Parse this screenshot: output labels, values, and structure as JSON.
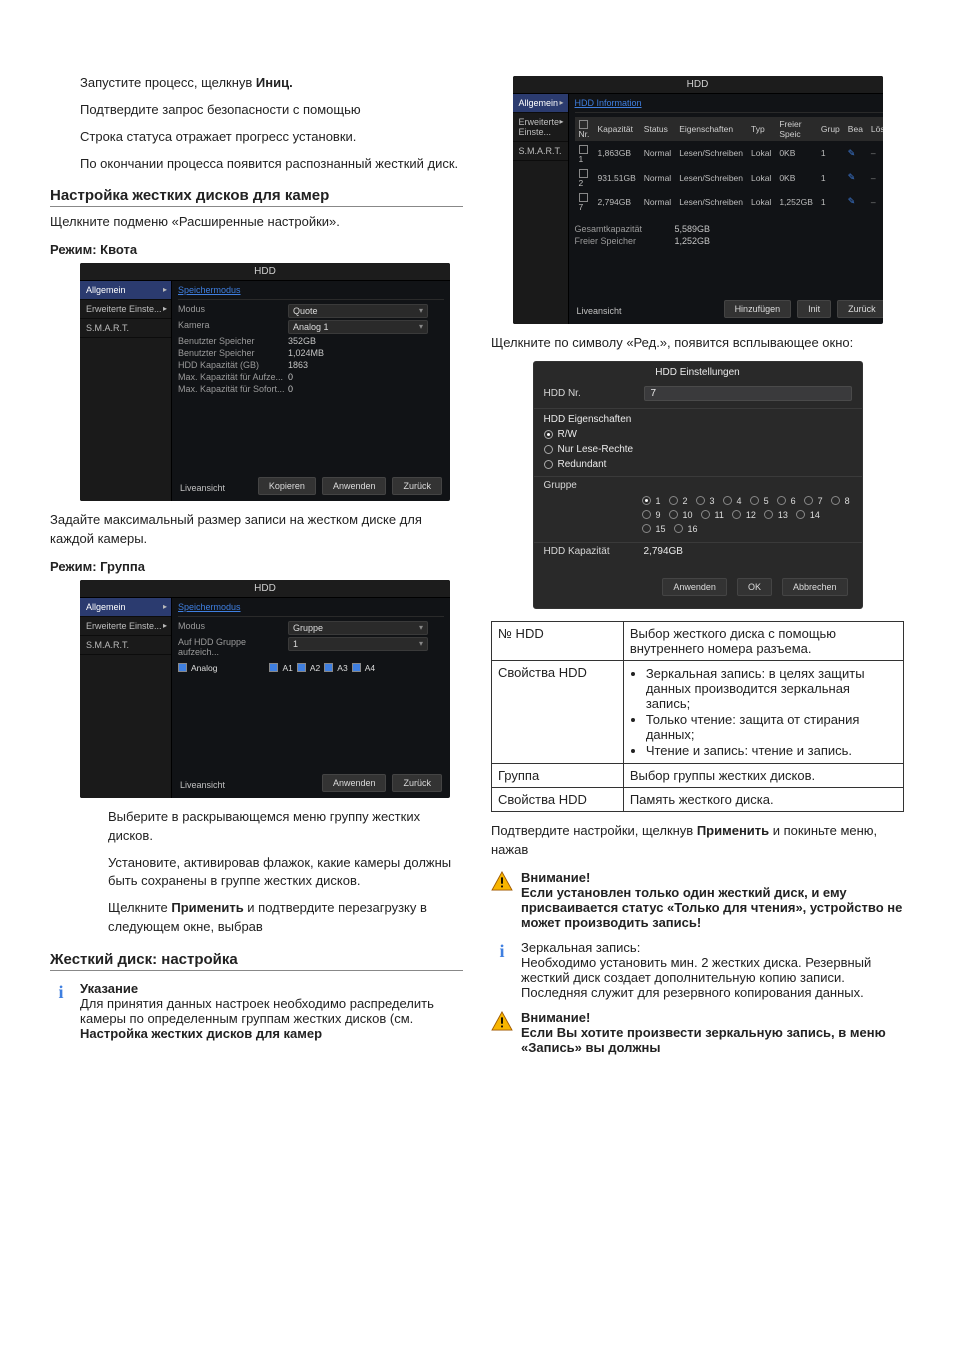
{
  "left": {
    "intro": [
      {
        "pre": "Запустите процесс, щелкнув ",
        "b": "Иниц.",
        "post": ""
      },
      {
        "pre": "Подтвердите запрос безопасности с помощью",
        "b": "",
        "post": ""
      }
    ],
    "intro2": [
      "Строка статуса отражает прогресс установки.",
      "По окончании процесса появится распознанный жесткий диск."
    ],
    "h_cam": "Настройка жестких дисков для камер",
    "p_cam": "Щелкните подменю «Расширенные настройки».",
    "mode_quota_h": "Режим: Квота",
    "quota_panel": {
      "title": "HDD",
      "side": [
        "Allgemein",
        "Erweiterte Einste...",
        "S.M.A.R.T."
      ],
      "tab": "Speichermodus",
      "rows": [
        {
          "k": "Modus",
          "v": "Quote",
          "dd": true
        },
        {
          "k": "Kamera",
          "v": "Analog 1",
          "dd": true
        },
        {
          "k": "Benutzter Speicher",
          "v": "352GB"
        },
        {
          "k": "Benutzter Speicher",
          "v": "1,024MB"
        },
        {
          "k": "HDD Kapazität (GB)",
          "v": "1863"
        },
        {
          "k": "Max. Kapazität für Aufze...",
          "v": "0"
        },
        {
          "k": "Max. Kapazität für Sofort...",
          "v": "0"
        }
      ],
      "btns": [
        "Kopieren",
        "Anwenden",
        "Zurück"
      ],
      "live": "Liveansicht"
    },
    "quota_desc": "Задайте максимальный размер записи на жестком диске для каждой камеры.",
    "mode_group_h": "Режим: Группа",
    "group_panel": {
      "title": "HDD",
      "side": [
        "Allgemein",
        "Erweiterte Einste...",
        "S.M.A.R.T."
      ],
      "tab": "Speichermodus",
      "rows": [
        {
          "k": "Modus",
          "v": "Gruppe",
          "dd": true
        },
        {
          "k": "Auf HDD Gruppe aufzeich...",
          "v": "1",
          "dd": true
        }
      ],
      "analog_label": "Analog",
      "checks": [
        "A1",
        "A2",
        "A3",
        "A4"
      ],
      "btns": [
        "Anwenden",
        "Zurück"
      ],
      "live": "Liveansicht"
    },
    "group_bullets": [
      "Выберите в раскрывающемся меню группу жестких дисков.",
      "Установите, активировав флажок, какие камеры должны быть сохранены в группе жестких дисков.",
      {
        "pre": "Щелкните ",
        "b": "Применить",
        "post": " и подтвердите перезагрузку в следующем окне, выбрав"
      }
    ],
    "h_hdd": "Жесткий диск: настройка",
    "note_h": "Указание",
    "note_body_1": "Для принятия данных настроек необходимо распределить камеры по определенным группам жестких дисков (см. ",
    "note_body_b": "Настройка жестких дисков для камер"
  },
  "right": {
    "info_panel": {
      "title": "HDD",
      "side": [
        "Allgemein",
        "Erweiterte Einste...",
        "S.M.A.R.T."
      ],
      "tab": "HDD Information",
      "cols": [
        "Nr.",
        "Kapazität",
        "Status",
        "Eigenschaften",
        "Typ",
        "Freier Speic",
        "Grup",
        "Bea",
        "Lös"
      ],
      "rows": [
        {
          "n": "1",
          "cap": "1,863GB",
          "st": "Normal",
          "pr": "Lesen/Schreiben",
          "ty": "Lokal",
          "fs": "0KB",
          "g": "1"
        },
        {
          "n": "2",
          "cap": "931.51GB",
          "st": "Normal",
          "pr": "Lesen/Schreiben",
          "ty": "Lokal",
          "fs": "0KB",
          "g": "1"
        },
        {
          "n": "7",
          "cap": "2,794GB",
          "st": "Normal",
          "pr": "Lesen/Schreiben",
          "ty": "Lokal",
          "fs": "1,252GB",
          "g": "1"
        }
      ],
      "total_k": "Gesamtkapazität",
      "total_v": "5,589GB",
      "free_k": "Freier Speicher",
      "free_v": "1,252GB",
      "btns": [
        "Hinzufügen",
        "Init",
        "Zurück"
      ],
      "live": "Liveansicht"
    },
    "p_edit": "Щелкните по символу «Ред.», появится всплывающее окно:",
    "modal": {
      "title": "HDD Einstellungen",
      "hdd_nr_k": "HDD Nr.",
      "hdd_nr_v": "7",
      "props_label": "HDD Eigenschaften",
      "radios": [
        "R/W",
        "Nur Lese-Rechte",
        "Redundant"
      ],
      "group_label": "Gruppe",
      "nums": [
        "1",
        "2",
        "3",
        "4",
        "5",
        "6",
        "7",
        "8",
        "9",
        "10",
        "11",
        "12",
        "13",
        "14",
        "15",
        "16"
      ],
      "cap_k": "HDD Kapazität",
      "cap_v": "2,794GB",
      "btns": [
        "Anwenden",
        "OK",
        "Abbrechen"
      ]
    },
    "table": {
      "rows": [
        {
          "k": "№ HDD",
          "v": [
            "Выбор жесткого диска с помощью внутреннего номера разъема."
          ]
        },
        {
          "k": "Свойства HDD",
          "list": [
            "Зеркальная запись: в целях защиты данных производится зеркальная запись;",
            "Только чтение: защита от стирания данных;",
            "Чтение и запись: чтение и запись."
          ]
        },
        {
          "k": "Группа",
          "v": [
            "Выбор группы жестких дисков."
          ]
        },
        {
          "k": "Свойства HDD",
          "v": [
            "Память жесткого диска."
          ]
        }
      ]
    },
    "confirm": {
      "pre": "Подтвердите настройки, щелкнув ",
      "b": "Применить",
      "post": " и покиньте меню, нажав"
    },
    "warn1": {
      "h": "Внимание!",
      "b": "Если установлен только один жесткий диск, и ему присваивается статус «Только для чтения», устройство не может производить запись!"
    },
    "note2": {
      "p1": "Зеркальная запись:",
      "p2": "Необходимо установить мин. 2 жестких диска. Резервный жесткий диск создает дополнительную копию записи. Последняя служит для резервного копирования данных."
    },
    "warn2": {
      "h": "Внимание!",
      "b": "Если Вы хотите произвести зеркальную запись, в меню «Запись» вы должны"
    }
  },
  "chart_data": {
    "type": "table",
    "title": "HDD Information",
    "columns": [
      "Nr.",
      "Kapazität",
      "Status",
      "Eigenschaften",
      "Typ",
      "Freier Speicher",
      "Gruppe"
    ],
    "rows": [
      [
        "1",
        "1,863GB",
        "Normal",
        "Lesen/Schreiben",
        "Lokal",
        "0KB",
        "1"
      ],
      [
        "2",
        "931.51GB",
        "Normal",
        "Lesen/Schreiben",
        "Lokal",
        "0KB",
        "1"
      ],
      [
        "7",
        "2,794GB",
        "Normal",
        "Lesen/Schreiben",
        "Lokal",
        "1,252GB",
        "1"
      ]
    ],
    "totals": {
      "Gesamtkapazität": "5,589GB",
      "Freier Speicher": "1,252GB"
    }
  }
}
